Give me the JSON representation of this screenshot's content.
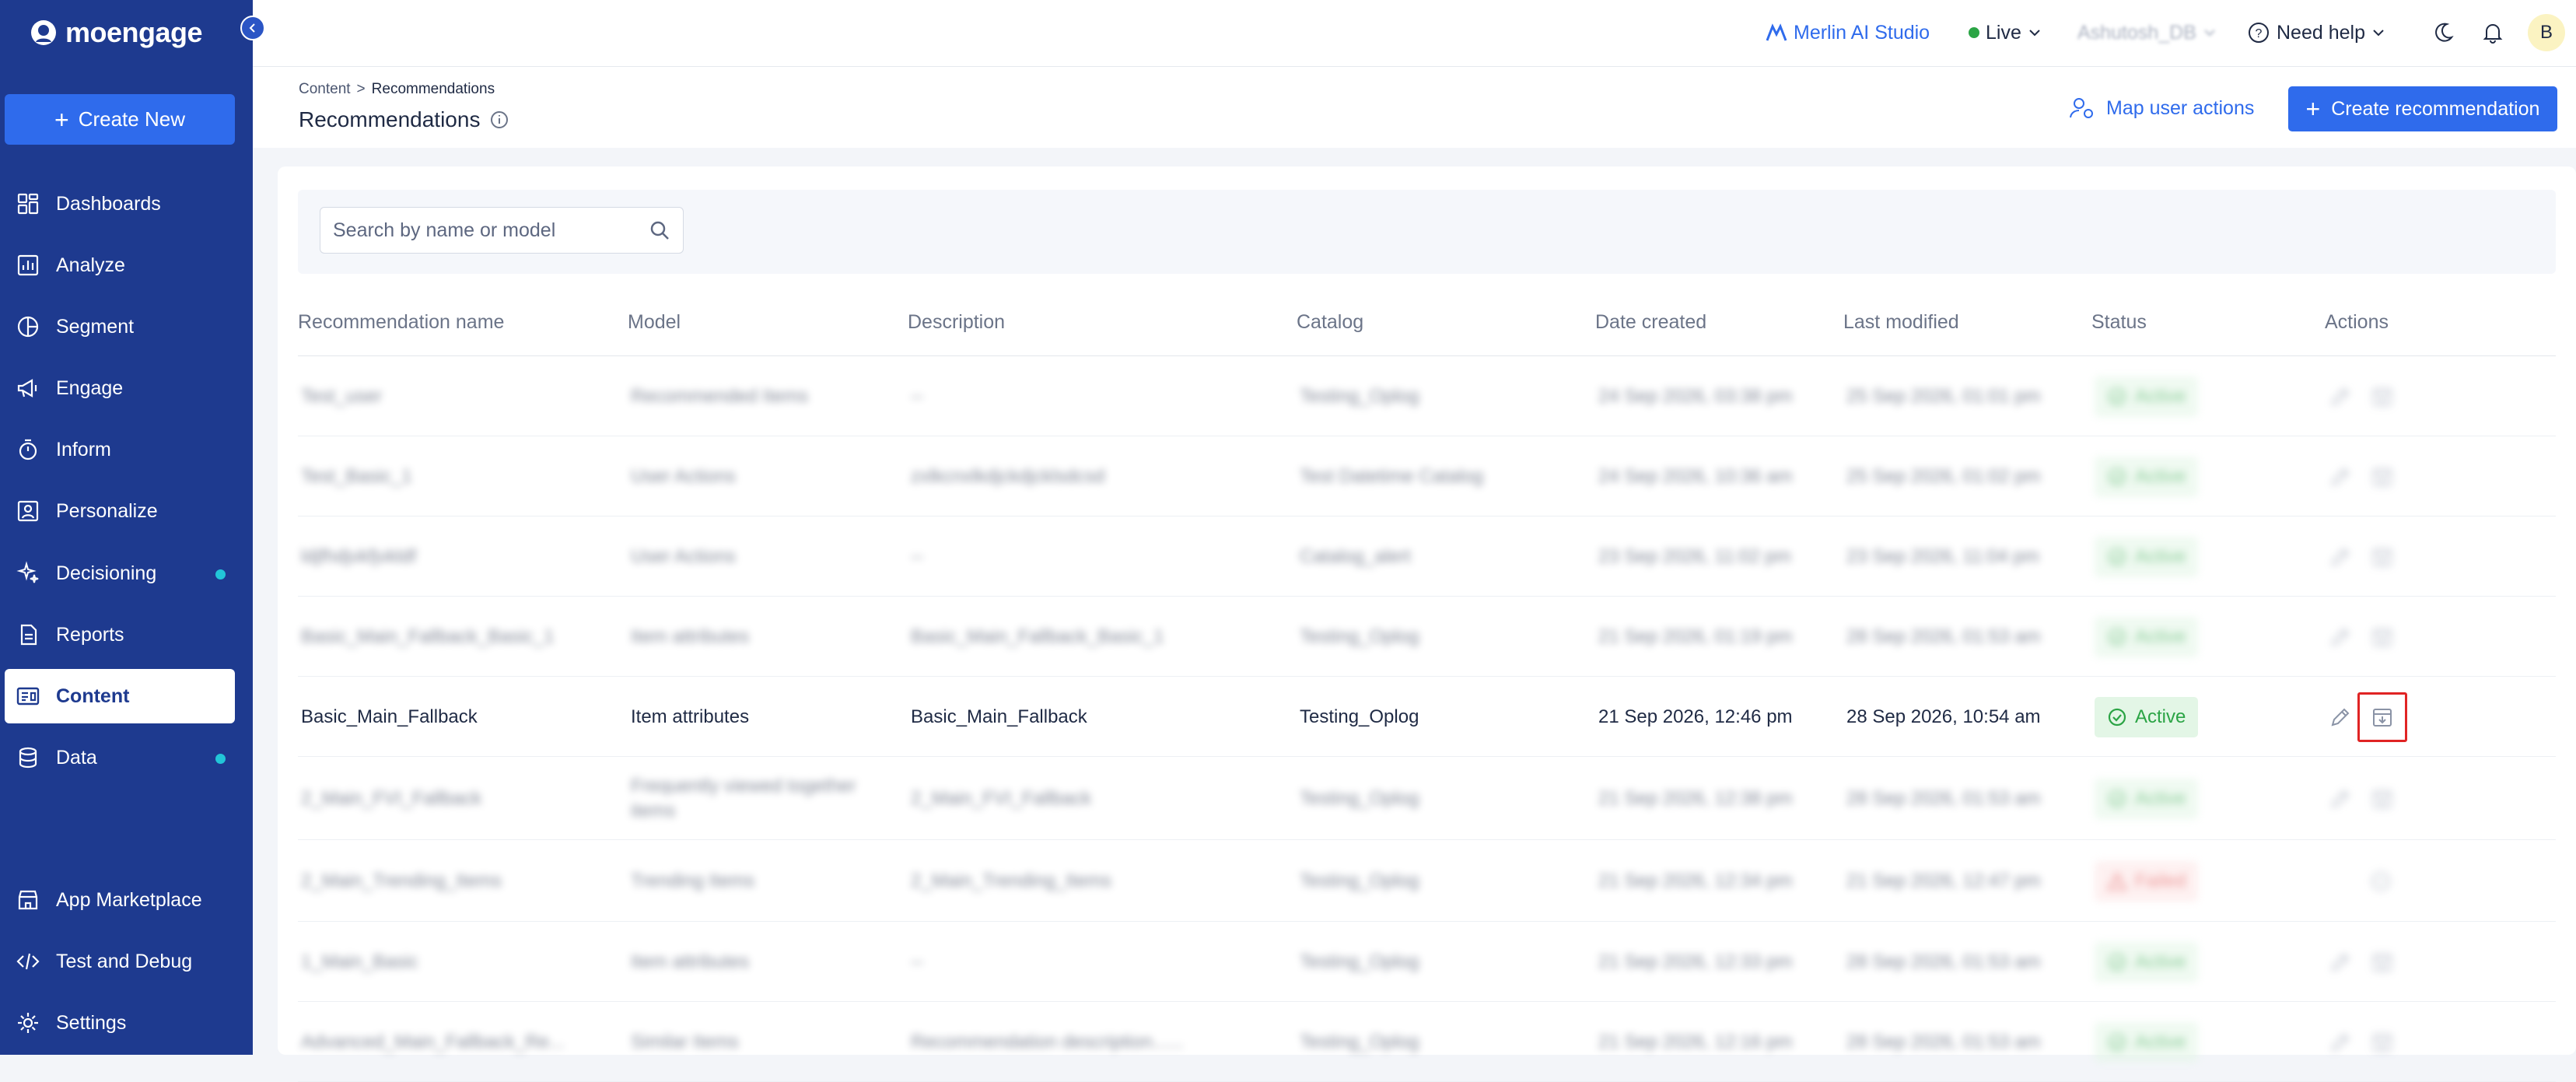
{
  "brand": {
    "name": "moengage"
  },
  "sidebar": {
    "create_label": "Create New",
    "items": [
      {
        "label": "Dashboards",
        "icon": "dashboard-icon"
      },
      {
        "label": "Analyze",
        "icon": "analyze-icon"
      },
      {
        "label": "Segment",
        "icon": "segment-icon"
      },
      {
        "label": "Engage",
        "icon": "engage-icon"
      },
      {
        "label": "Inform",
        "icon": "inform-icon"
      },
      {
        "label": "Personalize",
        "icon": "personalize-icon"
      },
      {
        "label": "Decisioning",
        "icon": "decisioning-icon",
        "dot": true
      },
      {
        "label": "Reports",
        "icon": "reports-icon"
      },
      {
        "label": "Content",
        "icon": "content-icon",
        "active": true
      },
      {
        "label": "Data",
        "icon": "data-icon",
        "dot": true
      }
    ],
    "bottom": [
      {
        "label": "App Marketplace",
        "icon": "marketplace-icon"
      },
      {
        "label": "Test and Debug",
        "icon": "code-icon"
      },
      {
        "label": "Settings",
        "icon": "gear-icon"
      }
    ]
  },
  "topbar": {
    "merlin": "Merlin AI Studio",
    "env": "Live",
    "user": "Ashutosh_DB",
    "help": "Need help",
    "avatar": "B"
  },
  "page": {
    "breadcrumb_root": "Content",
    "breadcrumb_sep": ">",
    "breadcrumb_current": "Recommendations",
    "title": "Recommendations",
    "map_actions": "Map user actions",
    "create_label": "Create recommendation"
  },
  "search": {
    "placeholder": "Search by name or model"
  },
  "table": {
    "headers": [
      "Recommendation name",
      "Model",
      "Description",
      "Catalog",
      "Date created",
      "Last modified",
      "Status",
      "Actions"
    ],
    "rows": [
      {
        "name": "Test_user",
        "model": "Recommended Items",
        "description": "--",
        "catalog": "Testing_Oplog",
        "created": "24 Sep 2026, 03:38 pm",
        "modified": "25 Sep 2026, 01:01 pm",
        "status": "Active",
        "blurred": true
      },
      {
        "name": "Test_Basic_1",
        "model": "User Actions",
        "description": "zxlkcnxlkdjckdjcklsdcsd",
        "catalog": "Test Datetime Catalog",
        "created": "24 Sep 2026, 10:36 am",
        "modified": "25 Sep 2026, 01:02 pm",
        "status": "Active",
        "blurred": true
      },
      {
        "name": "ldjfhdjvkfjvkldf",
        "model": "User Actions",
        "description": "--",
        "catalog": "Catalog_alert",
        "created": "23 Sep 2026, 11:02 pm",
        "modified": "23 Sep 2026, 11:04 pm",
        "status": "Active",
        "blurred": true
      },
      {
        "name": "Basic_Main_Fallback_Basic_1",
        "model": "Item attributes",
        "description": "Basic_Main_Fallback_Basic_1",
        "catalog": "Testing_Oplog",
        "created": "21 Sep 2026, 01:19 pm",
        "modified": "28 Sep 2026, 01:53 am",
        "status": "Active",
        "blurred": true
      },
      {
        "name": "Basic_Main_Fallback",
        "model": "Item attributes",
        "description": "Basic_Main_Fallback",
        "catalog": "Testing_Oplog",
        "created": "21 Sep 2026, 12:46 pm",
        "modified": "28 Sep 2026, 10:54 am",
        "status": "Active",
        "blurred": false,
        "highlight": true
      },
      {
        "name": "2_Main_FVI_Fallback",
        "model": "Frequently viewed together items",
        "description": "2_Main_FVI_Fallback",
        "catalog": "Testing_Oplog",
        "created": "21 Sep 2026, 12:38 pm",
        "modified": "28 Sep 2026, 01:53 am",
        "status": "Active",
        "blurred": true
      },
      {
        "name": "2_Main_Trending_Items",
        "model": "Trending Items",
        "description": "2_Main_Trending_Items",
        "catalog": "Testing_Oplog",
        "created": "21 Sep 2026, 12:34 pm",
        "modified": "21 Sep 2026, 12:47 pm",
        "status": "Failed",
        "blurred": true
      },
      {
        "name": "1_Main_Basic",
        "model": "Item attributes",
        "description": "--",
        "catalog": "Testing_Oplog",
        "created": "21 Sep 2026, 12:33 pm",
        "modified": "28 Sep 2026, 01:53 am",
        "status": "Active",
        "blurred": true
      },
      {
        "name": "Advanced_Main_Fallback_Re...",
        "model": "Similar Items",
        "description": "Recommendation description......",
        "catalog": "Testing_Oplog",
        "created": "21 Sep 2026, 12:16 pm",
        "modified": "28 Sep 2026, 01:53 am",
        "status": "Active",
        "blurred": true
      }
    ]
  },
  "colors": {
    "sidebar": "#1e3a8f",
    "primary": "#2f6bec",
    "active_green": "#2ba445",
    "failed_red": "#e04848",
    "highlight": "#e02424"
  }
}
